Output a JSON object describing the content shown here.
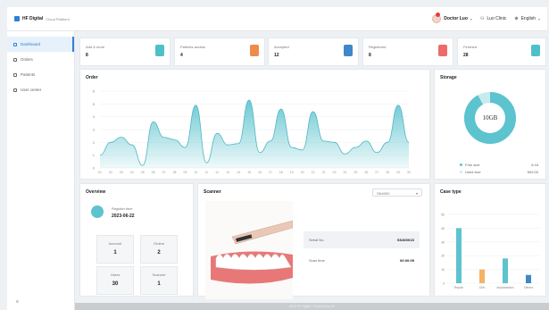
{
  "app": {
    "name": "HF Digital",
    "subtitle": "Cloud Platform"
  },
  "header": {
    "user_name": "Doctor Luo",
    "account": "Luo Clinic",
    "language": "English"
  },
  "sidebar": {
    "items": [
      {
        "label": "Dashboard",
        "active": true
      },
      {
        "label": "Orders",
        "active": false
      },
      {
        "label": "Patients",
        "active": false
      },
      {
        "label": "User center",
        "active": false
      }
    ],
    "collapse": "≡"
  },
  "stats": [
    {
      "label": "Add & more",
      "value": "8",
      "color": "#4fc0c9"
    },
    {
      "label": "Patients access",
      "value": "4",
      "color": "#f08a4b"
    },
    {
      "label": "Accepted",
      "value": "12",
      "color": "#3f87c9"
    },
    {
      "label": "Registered",
      "value": "8",
      "color": "#ee6b6b"
    },
    {
      "label": "Finished",
      "value": "28",
      "color": "#4fc0c9"
    }
  ],
  "order_chart": {
    "title": "Order",
    "chart_data": {
      "type": "area",
      "x": [
        "01",
        "02",
        "03",
        "04",
        "05",
        "06",
        "07",
        "08",
        "09",
        "10",
        "11",
        "12",
        "13",
        "14",
        "15",
        "16",
        "17",
        "18",
        "19",
        "20",
        "21",
        "22",
        "23",
        "24",
        "25",
        "26",
        "27",
        "28",
        "29",
        "30"
      ],
      "values": [
        1.0,
        2.0,
        2.4,
        1.8,
        0.2,
        3.6,
        2.4,
        2.2,
        1.6,
        4.9,
        0.4,
        2.7,
        1.8,
        1.9,
        5.3,
        1.2,
        2.1,
        4.6,
        1.6,
        1.4,
        4.4,
        2.1,
        2.0,
        1.1,
        1.6,
        2.1,
        1.2,
        2.0,
        4.9,
        2.0
      ],
      "ylim": [
        0,
        6
      ],
      "yticks": [
        "0",
        "1",
        "2",
        "3",
        "4",
        "5",
        "6"
      ]
    }
  },
  "storage": {
    "title": "Storage",
    "center_label": "10GB",
    "legend": [
      {
        "label": "Free size",
        "value": "8.18",
        "color": "#5cc3cf"
      },
      {
        "label": "Used size",
        "value": "653.00",
        "color": "#c8ebee"
      }
    ],
    "chart_data": {
      "type": "pie",
      "categories": [
        "Free size",
        "Used size"
      ],
      "values": [
        92,
        8
      ]
    }
  },
  "overview": {
    "title": "Overview",
    "register_label": "Register time",
    "register_date": "2023-06-22",
    "boxes": [
      {
        "label": "Account",
        "value": "1"
      },
      {
        "label": "Orders",
        "value": "2"
      },
      {
        "label": "Users",
        "value": "30"
      },
      {
        "label": "Scanner",
        "value": "1"
      }
    ]
  },
  "scanner": {
    "title": "Scanner",
    "select_value": "SN4000",
    "rows": [
      {
        "label": "Serial No.",
        "value": "SS40001S"
      },
      {
        "label": "Scan time",
        "value": "00:00:05"
      }
    ]
  },
  "case_type": {
    "title": "Case type",
    "chart_data": {
      "type": "bar",
      "categories": [
        "Repair",
        "Orth",
        "Implantation",
        "Others"
      ],
      "values": [
        40,
        10,
        18,
        6
      ],
      "colors": [
        "#5cc3cf",
        "#f4b266",
        "#5cc3cf",
        "#3f87c9"
      ],
      "ylim": [
        0,
        50
      ],
      "yticks": [
        "0",
        "10",
        "20",
        "30",
        "40",
        "50"
      ]
    }
  },
  "footer": {
    "text": "2023 HF Digital · Powered by HF"
  }
}
